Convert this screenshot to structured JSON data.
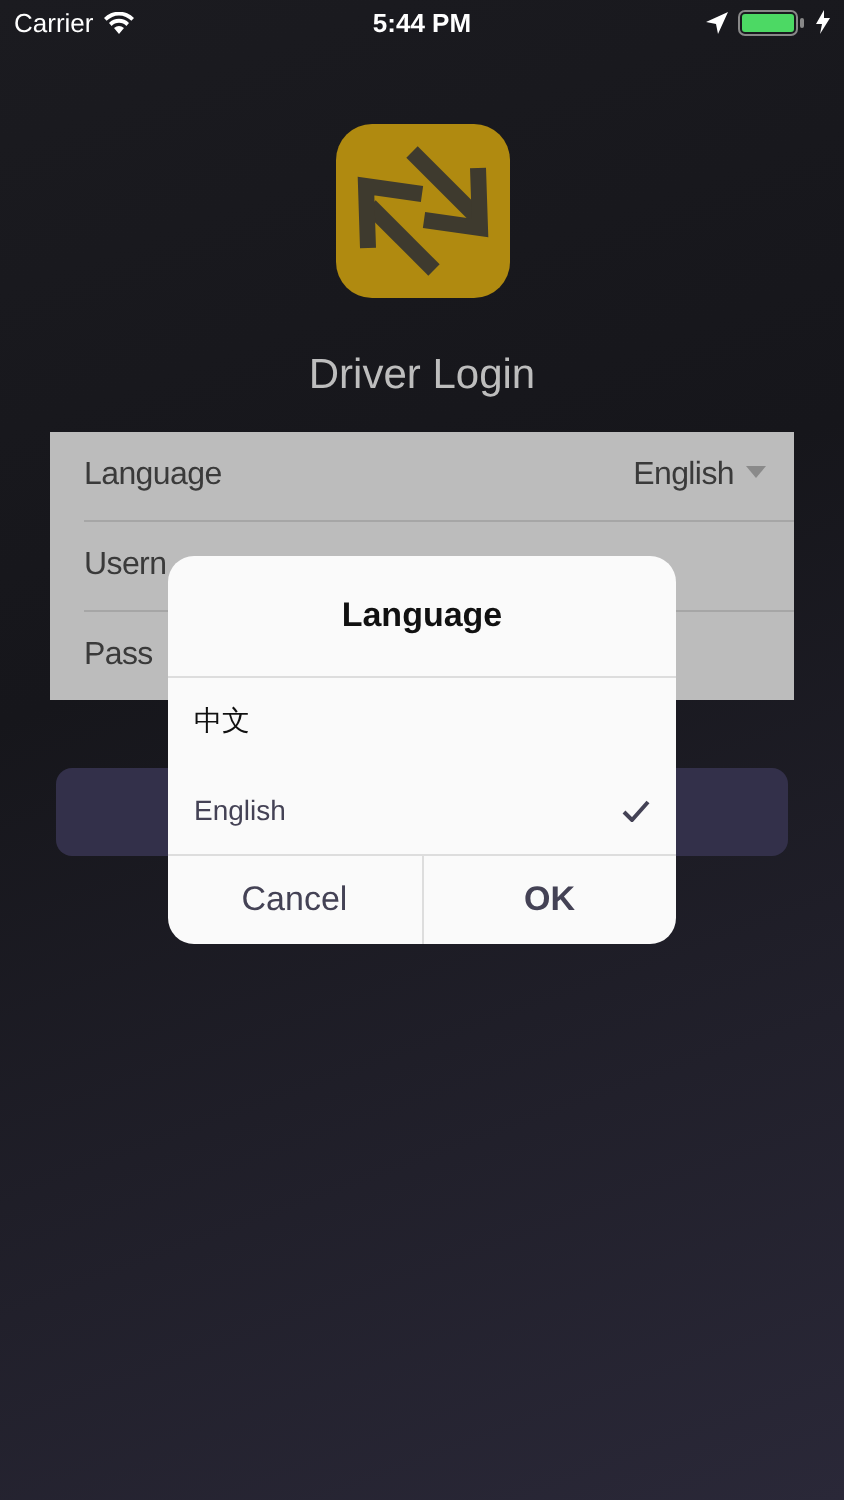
{
  "status_bar": {
    "carrier": "Carrier",
    "time": "5:44 PM"
  },
  "title": "Driver Login",
  "form": {
    "rows": [
      {
        "kind": "select",
        "label": "Language",
        "value": "English"
      },
      {
        "kind": "text",
        "label": "Usern"
      },
      {
        "kind": "text",
        "label": "Pass"
      }
    ]
  },
  "dialog": {
    "title": "Language",
    "options": [
      {
        "label": "中文",
        "selected": false
      },
      {
        "label": "English",
        "selected": true
      }
    ],
    "buttons": [
      {
        "label": "Cancel",
        "kind": "cancel"
      },
      {
        "label": "OK",
        "kind": "primary"
      }
    ]
  }
}
